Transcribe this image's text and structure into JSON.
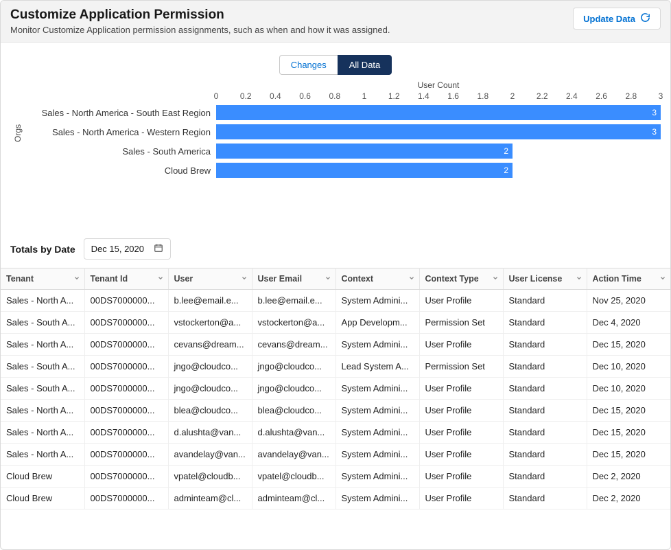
{
  "header": {
    "title": "Customize Application Permission",
    "subtitle": "Monitor Customize Application permission assignments, such as when and how it was assigned.",
    "update_label": "Update Data"
  },
  "tabs": {
    "changes": "Changes",
    "all_data": "All Data"
  },
  "chart_data": {
    "type": "bar",
    "orientation": "horizontal",
    "xlabel": "User Count",
    "ylabel": "Orgs",
    "xlim": [
      0,
      3
    ],
    "xticks": [
      0,
      0.2,
      0.4,
      0.6,
      0.8,
      1,
      1.2,
      1.4,
      1.6,
      1.8,
      2,
      2.2,
      2.4,
      2.6,
      2.8,
      3
    ],
    "categories": [
      "Sales - North America - South East Region",
      "Sales - North America - Western Region",
      "Sales - South America",
      "Cloud Brew"
    ],
    "values": [
      3,
      3,
      2,
      2
    ]
  },
  "totals": {
    "label": "Totals by Date",
    "date": "Dec 15, 2020"
  },
  "columns": [
    "Tenant",
    "Tenant Id",
    "User",
    "User Email",
    "Context",
    "Context Type",
    "User License",
    "Action Time"
  ],
  "rows": [
    {
      "tenant": "Sales - North A...",
      "tenant_id": "00DS7000000...",
      "user": "b.lee@email.e...",
      "email": "b.lee@email.e...",
      "context": "System Admini...",
      "ctype": "User Profile",
      "license": "Standard",
      "time": "Nov 25, 2020"
    },
    {
      "tenant": "Sales - South A...",
      "tenant_id": "00DS7000000...",
      "user": "vstockerton@a...",
      "email": "vstockerton@a...",
      "context": "App Developm...",
      "ctype": "Permission Set",
      "license": "Standard",
      "time": "Dec 4, 2020"
    },
    {
      "tenant": "Sales - North A...",
      "tenant_id": "00DS7000000...",
      "user": "cevans@dream...",
      "email": "cevans@dream...",
      "context": "System Admini...",
      "ctype": "User Profile",
      "license": "Standard",
      "time": "Dec 15, 2020"
    },
    {
      "tenant": "Sales - South A...",
      "tenant_id": "00DS7000000...",
      "user": "jngo@cloudco...",
      "email": "jngo@cloudco...",
      "context": "Lead System A...",
      "ctype": "Permission Set",
      "license": "Standard",
      "time": "Dec 10, 2020"
    },
    {
      "tenant": "Sales - South A...",
      "tenant_id": "00DS7000000...",
      "user": "jngo@cloudco...",
      "email": "jngo@cloudco...",
      "context": "System Admini...",
      "ctype": "User Profile",
      "license": "Standard",
      "time": "Dec 10, 2020"
    },
    {
      "tenant": "Sales - North A...",
      "tenant_id": "00DS7000000...",
      "user": "blea@cloudco...",
      "email": "blea@cloudco...",
      "context": "System Admini...",
      "ctype": "User Profile",
      "license": "Standard",
      "time": "Dec 15, 2020"
    },
    {
      "tenant": "Sales - North A...",
      "tenant_id": "00DS7000000...",
      "user": "d.alushta@van...",
      "email": "d.alushta@van...",
      "context": "System Admini...",
      "ctype": "User Profile",
      "license": "Standard",
      "time": "Dec 15, 2020"
    },
    {
      "tenant": "Sales - North A...",
      "tenant_id": "00DS7000000...",
      "user": "avandelay@van...",
      "email": "avandelay@van...",
      "context": "System Admini...",
      "ctype": "User Profile",
      "license": "Standard",
      "time": "Dec 15, 2020"
    },
    {
      "tenant": "Cloud Brew",
      "tenant_id": "00DS7000000...",
      "user": "vpatel@cloudb...",
      "email": "vpatel@cloudb...",
      "context": "System Admini...",
      "ctype": "User Profile",
      "license": "Standard",
      "time": "Dec 2, 2020"
    },
    {
      "tenant": "Cloud Brew",
      "tenant_id": "00DS7000000...",
      "user": "adminteam@cl...",
      "email": "adminteam@cl...",
      "context": "System Admini...",
      "ctype": "User Profile",
      "license": "Standard",
      "time": "Dec 2, 2020"
    }
  ]
}
